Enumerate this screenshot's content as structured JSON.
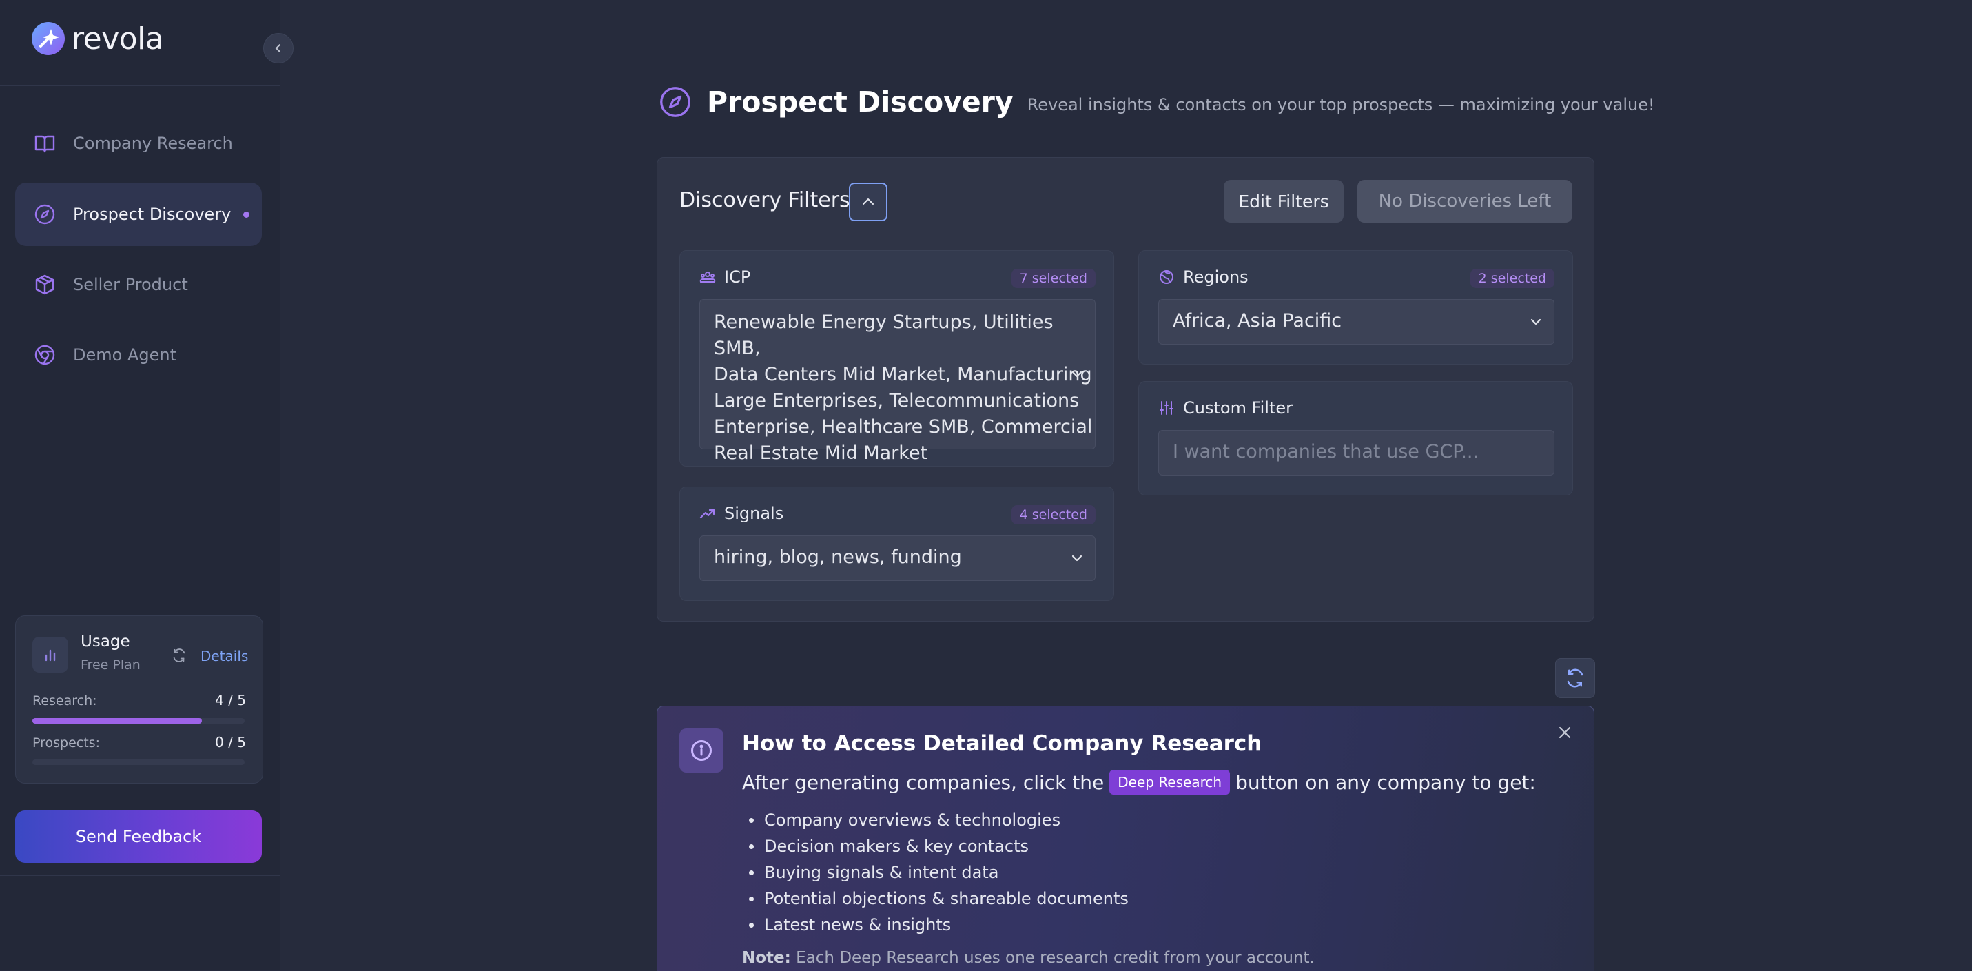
{
  "brand": {
    "name": "revola"
  },
  "sidebar": {
    "items": [
      {
        "label": "Company Research",
        "icon": "book-icon"
      },
      {
        "label": "Prospect Discovery",
        "icon": "compass-icon",
        "active": true
      },
      {
        "label": "Seller Product",
        "icon": "box-icon"
      },
      {
        "label": "Demo Agent",
        "icon": "chrome-icon"
      }
    ],
    "usage": {
      "title": "Usage",
      "plan": "Free Plan",
      "details_label": "Details",
      "research_label": "Research:",
      "research_value": "4 / 5",
      "research_progress": 0.8,
      "prospects_label": "Prospects:",
      "prospects_value": "0 / 5",
      "prospects_progress": 0
    },
    "feedback_label": "Send Feedback"
  },
  "header": {
    "title": "Prospect Discovery",
    "subtitle": "Reveal insights & contacts on your top prospects — maximizing your value!"
  },
  "filters": {
    "title": "Discovery Filters",
    "edit_label": "Edit Filters",
    "no_discoveries_label": "No Discoveries Left",
    "icp": {
      "label": "ICP",
      "badge": "7 selected",
      "lines": [
        "Renewable Energy Startups, Utilities SMB,",
        "Data Centers Mid Market, Manufacturing",
        "Large Enterprises, Telecommunications",
        "Enterprise, Healthcare SMB, Commercial",
        "Real Estate Mid Market"
      ]
    },
    "regions": {
      "label": "Regions",
      "badge": "2 selected",
      "value": "Africa, Asia Pacific"
    },
    "custom": {
      "label": "Custom Filter",
      "placeholder": "I want companies that use GCP..."
    },
    "signals": {
      "label": "Signals",
      "badge": "4 selected",
      "value": "hiring, blog, news, funding"
    }
  },
  "info": {
    "title": "How to Access Detailed Company Research",
    "line_before": "After generating companies, click the",
    "tag": "Deep Research",
    "line_after": "button on any company to get:",
    "bullets": [
      "Company overviews & technologies",
      "Decision makers & key contacts",
      "Buying signals & intent data",
      "Potential objections & shareable documents",
      "Latest news & insights"
    ],
    "note_label": "Note:",
    "note_text": "Each Deep Research uses one research credit from your account."
  },
  "colors": {
    "accent": "#9d63e8",
    "link": "#7ea2f3",
    "background": "#262b3c",
    "sidebar": "#232838"
  }
}
